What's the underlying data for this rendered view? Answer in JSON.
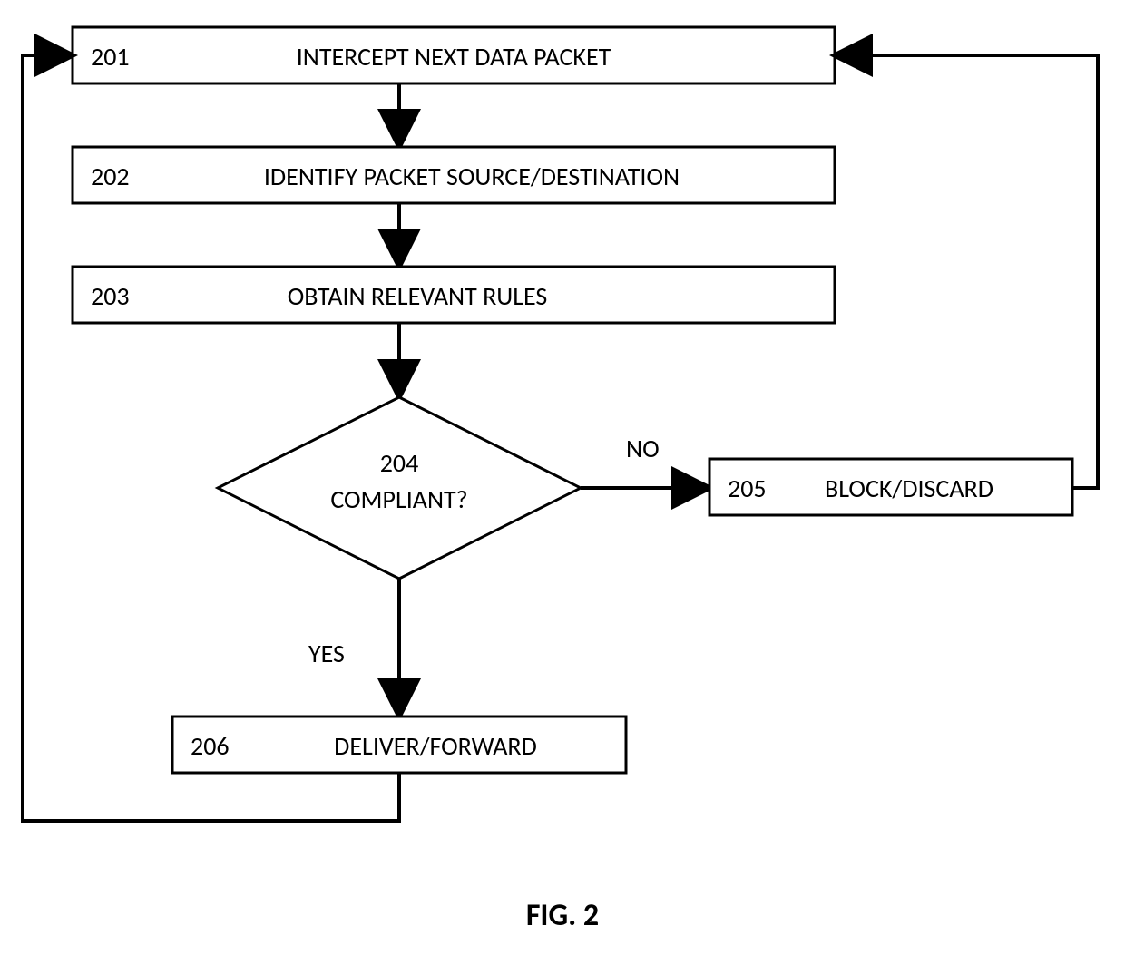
{
  "figure_label": "FIG. 2",
  "nodes": {
    "n201": {
      "num": "201",
      "text": "INTERCEPT NEXT DATA PACKET"
    },
    "n202": {
      "num": "202",
      "text": "IDENTIFY PACKET SOURCE/DESTINATION"
    },
    "n203": {
      "num": "203",
      "text": "OBTAIN RELEVANT RULES"
    },
    "n204": {
      "num": "204",
      "text": "COMPLIANT?"
    },
    "n205": {
      "num": "205",
      "text": "BLOCK/DISCARD"
    },
    "n206": {
      "num": "206",
      "text": "DELIVER/FORWARD"
    }
  },
  "edges": {
    "no": "NO",
    "yes": "YES"
  }
}
